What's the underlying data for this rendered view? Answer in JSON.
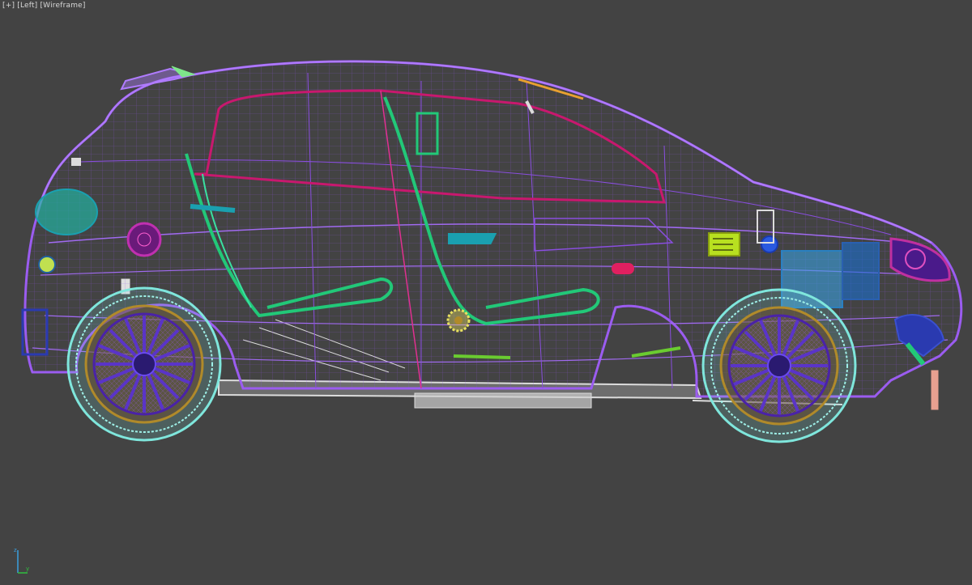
{
  "viewport": {
    "label_plus": "[+]",
    "label_view": "[Left]",
    "label_shading": "[Wireframe]"
  },
  "colors": {
    "background": "#434343",
    "body_wire": "#9b5cf0",
    "frame_magenta": "#c8186e",
    "seat_green": "#22c878",
    "tire_cyan": "#7fe6dc",
    "rim_purple": "#4a22a8",
    "rim_gold": "#b08a2a",
    "chassis_white": "#dcdcdc"
  },
  "gizmo": {
    "y_axis_label": "y",
    "z_axis_label": "z"
  }
}
